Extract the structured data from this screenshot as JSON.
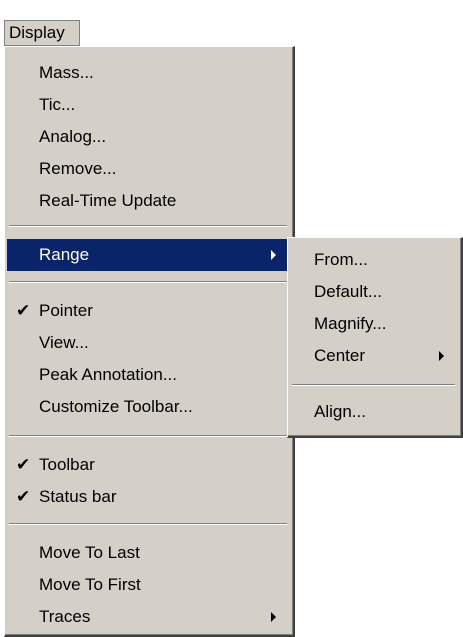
{
  "menubar": {
    "display_label": "Display"
  },
  "main_menu": {
    "group1": [
      "Mass...",
      "Tic...",
      "Analog...",
      "Remove...",
      "Real-Time Update"
    ],
    "range_label": "Range",
    "group3": [
      "Pointer",
      "View...",
      "Peak Annotation...",
      "Customize Toolbar..."
    ],
    "group4": [
      "Toolbar",
      "Status bar"
    ],
    "group5": [
      "Move To Last",
      "Move To First",
      "Traces"
    ],
    "check_glyph": "✔"
  },
  "range_submenu": {
    "items": [
      "From...",
      "Default...",
      "Magnify...",
      "Center"
    ],
    "align_label": "Align..."
  },
  "colors": {
    "menu_bg": "#d4d0c8",
    "highlight_bg": "#0a246a",
    "highlight_text": "#ffffff"
  },
  "icons": {
    "checked": "check-mark-icon",
    "submenu": "submenu-arrow-icon"
  }
}
